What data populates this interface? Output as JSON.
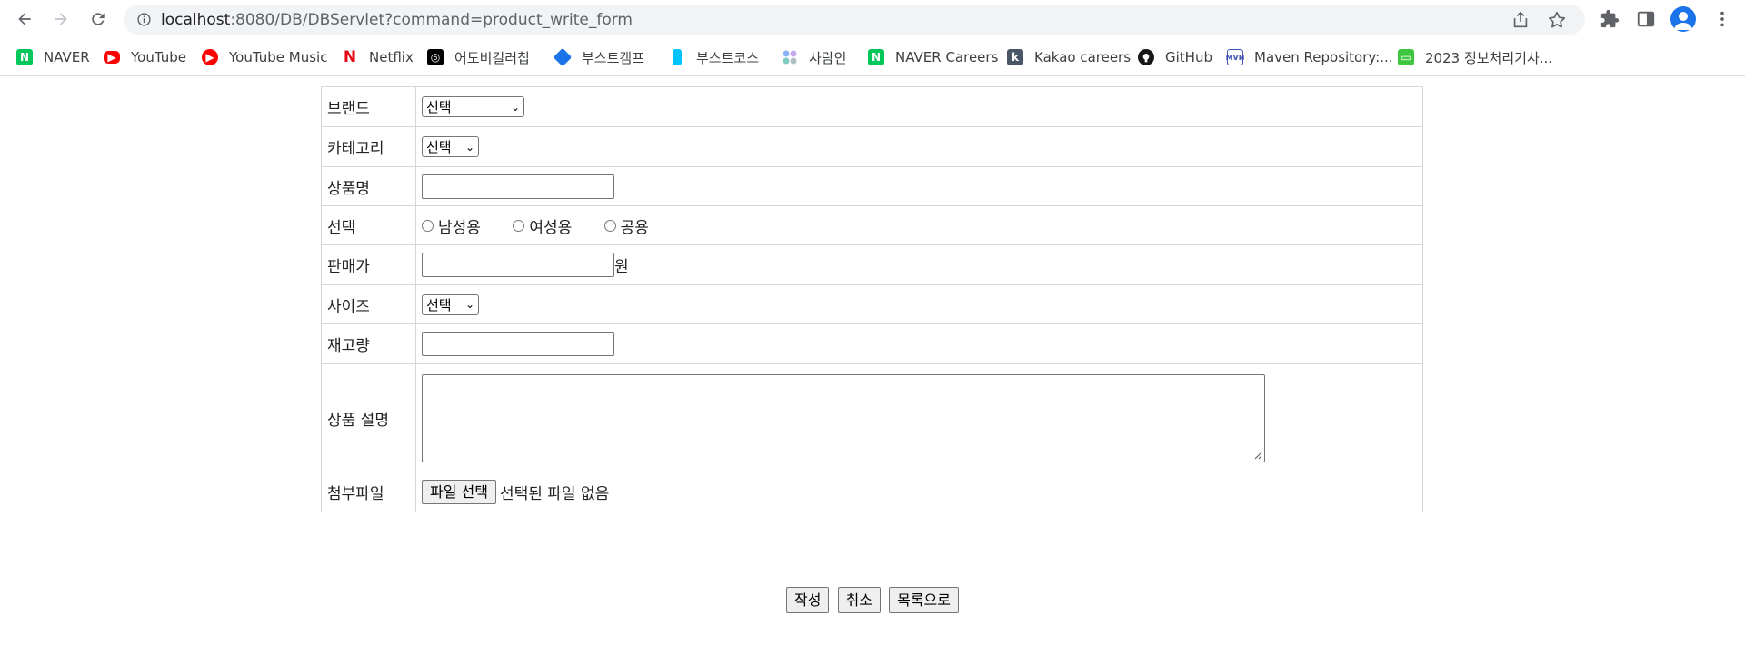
{
  "browser": {
    "url_host": "localhost",
    "url_path": ":8080/DB/DBServlet?command=product_write_form"
  },
  "bookmarks": [
    {
      "label": "NAVER",
      "icon": "naver-icon",
      "color": "#03c75a"
    },
    {
      "label": "YouTube",
      "icon": "youtube-icon",
      "color": "#ff0000"
    },
    {
      "label": "YouTube Music",
      "icon": "youtube-music-icon",
      "color": "#ff0000"
    },
    {
      "label": "Netflix",
      "icon": "netflix-icon",
      "color": "#e50914"
    },
    {
      "label": "어도비컬러칩",
      "icon": "adobe-color-icon",
      "color": "#000000"
    },
    {
      "label": "부스트캠프",
      "icon": "boostcamp-icon",
      "color": "#1a73e8"
    },
    {
      "label": "부스트코스",
      "icon": "boostcourse-icon",
      "color": "#00c4ff"
    },
    {
      "label": "사람인",
      "icon": "saramin-icon",
      "color": "#5a8fe8"
    },
    {
      "label": "NAVER Careers",
      "icon": "naver-careers-icon",
      "color": "#03c75a"
    },
    {
      "label": "Kakao careers",
      "icon": "kakao-icon",
      "color": "#4a5568"
    },
    {
      "label": "GitHub",
      "icon": "github-icon",
      "color": "#181717"
    },
    {
      "label": "Maven Repository:...",
      "icon": "maven-icon",
      "color": "#3f51b5"
    },
    {
      "label": "2023 정보처리기사...",
      "icon": "chat-icon",
      "color": "#3ec63e"
    }
  ],
  "form": {
    "brand": {
      "label": "브랜드",
      "selected": "선택"
    },
    "category": {
      "label": "카테고리",
      "selected": "선택"
    },
    "product_name": {
      "label": "상품명",
      "value": ""
    },
    "gender": {
      "label": "선택",
      "options": [
        "남성용",
        "여성용",
        "공용"
      ]
    },
    "price": {
      "label": "판매가",
      "value": "",
      "unit": "원"
    },
    "size": {
      "label": "사이즈",
      "selected": "선택"
    },
    "stock": {
      "label": "재고량",
      "value": ""
    },
    "description": {
      "label": "상품 설명",
      "value": ""
    },
    "attachment": {
      "label": "첨부파일",
      "button": "파일 선택",
      "status": "선택된 파일 없음"
    }
  },
  "actions": {
    "submit": "작성",
    "cancel": "취소",
    "list": "목록으로"
  }
}
